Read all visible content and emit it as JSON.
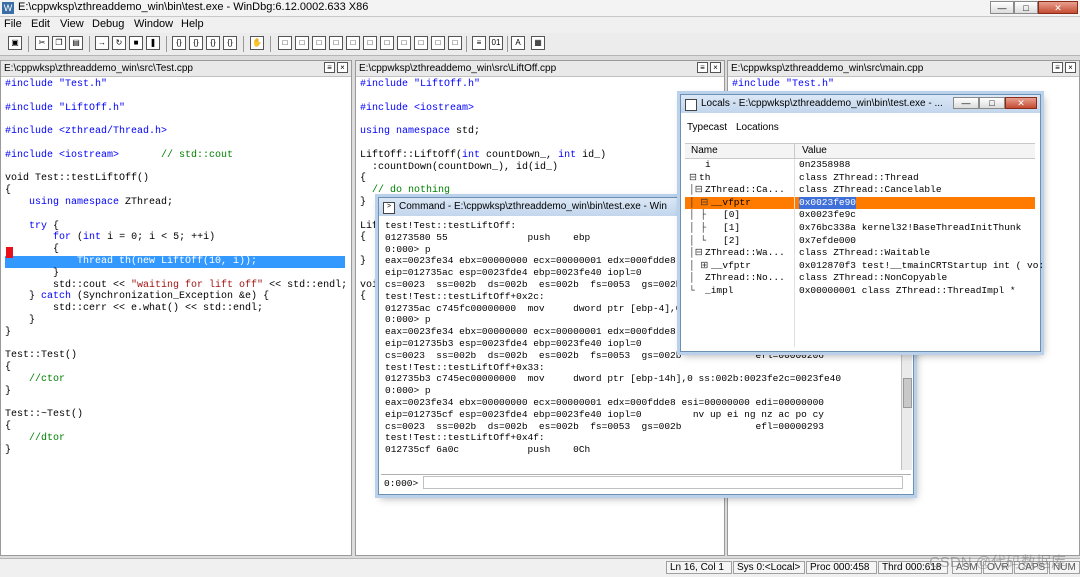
{
  "app": {
    "title": "E:\\cppwksp\\zthreaddemo_win\\bin\\test.exe - WinDbg:6.12.0002.633 X86",
    "icon": "windbg-icon"
  },
  "menu": [
    "File",
    "Edit",
    "View",
    "Debug",
    "Window",
    "Help"
  ],
  "panes": {
    "test": {
      "path": "E:\\cppwksp\\zthreaddemo_win\\src\\Test.cpp",
      "lines": [
        [
          {
            "t": "#include \"Test.h\"",
            "c": "kw"
          }
        ],
        [
          {
            "t": "",
            "c": ""
          }
        ],
        [
          {
            "t": "#include \"LiftOff.h\"",
            "c": "kw"
          }
        ],
        [
          {
            "t": "",
            "c": ""
          }
        ],
        [
          {
            "t": "#include <zthread/Thread.h>",
            "c": "kw"
          }
        ],
        [
          {
            "t": "",
            "c": ""
          }
        ],
        [
          {
            "t": "#include <iostream>",
            "c": "kw"
          },
          {
            "t": "       // std::cout",
            "c": "cm"
          }
        ],
        [
          {
            "t": "",
            "c": ""
          }
        ],
        [
          {
            "t": "void Test::testLiftOff()",
            "c": ""
          }
        ],
        [
          {
            "t": "{",
            "c": ""
          }
        ],
        [
          {
            "t": "    ",
            "c": ""
          },
          {
            "t": "using namespace",
            "c": "kw"
          },
          {
            "t": " ZThread;",
            "c": ""
          }
        ],
        [
          {
            "t": "",
            "c": ""
          }
        ],
        [
          {
            "t": "    ",
            "c": ""
          },
          {
            "t": "try",
            "c": "kw"
          },
          {
            "t": " {",
            "c": ""
          }
        ],
        [
          {
            "t": "        ",
            "c": ""
          },
          {
            "t": "for",
            "c": "kw"
          },
          {
            "t": " (",
            "c": ""
          },
          {
            "t": "int",
            "c": "kw"
          },
          {
            "t": " i = 0; i < 5; ++i)",
            "c": ""
          }
        ],
        [
          {
            "t": "        {",
            "c": ""
          }
        ],
        [
          {
            "t": "            Thread th(new LiftOff(10, i));",
            "c": "hl"
          }
        ],
        [
          {
            "t": "        }",
            "c": ""
          }
        ],
        [
          {
            "t": "        std::cout << ",
            "c": ""
          },
          {
            "t": "\"waiting for lift off\"",
            "c": "str"
          },
          {
            "t": " << std::endl;",
            "c": ""
          }
        ],
        [
          {
            "t": "    } ",
            "c": ""
          },
          {
            "t": "catch",
            "c": "kw"
          },
          {
            "t": " (Synchronization_Exception &e) {",
            "c": ""
          }
        ],
        [
          {
            "t": "        std::cerr << e.what() << std::endl;",
            "c": ""
          }
        ],
        [
          {
            "t": "    }",
            "c": ""
          }
        ],
        [
          {
            "t": "}",
            "c": ""
          }
        ],
        [
          {
            "t": "",
            "c": ""
          }
        ],
        [
          {
            "t": "Test::Test()",
            "c": ""
          }
        ],
        [
          {
            "t": "{",
            "c": ""
          }
        ],
        [
          {
            "t": "    ",
            "c": ""
          },
          {
            "t": "//ctor",
            "c": "cm"
          }
        ],
        [
          {
            "t": "}",
            "c": ""
          }
        ],
        [
          {
            "t": "",
            "c": ""
          }
        ],
        [
          {
            "t": "Test::~Test()",
            "c": ""
          }
        ],
        [
          {
            "t": "{",
            "c": ""
          }
        ],
        [
          {
            "t": "    ",
            "c": ""
          },
          {
            "t": "//dtor",
            "c": "cm"
          }
        ],
        [
          {
            "t": "}",
            "c": ""
          }
        ]
      ]
    },
    "liftoff": {
      "path": "E:\\cppwksp\\zthreaddemo_win\\src\\LiftOff.cpp",
      "lines": [
        [
          {
            "t": "#include \"LiftOff.h\"",
            "c": "kw"
          }
        ],
        [
          {
            "t": "",
            "c": ""
          }
        ],
        [
          {
            "t": "#include <iostream>",
            "c": "kw"
          }
        ],
        [
          {
            "t": "",
            "c": ""
          }
        ],
        [
          {
            "t": "using namespace",
            "c": "kw"
          },
          {
            "t": " std;",
            "c": ""
          }
        ],
        [
          {
            "t": "",
            "c": ""
          }
        ],
        [
          {
            "t": "LiftOff::LiftOff(",
            "c": ""
          },
          {
            "t": "int",
            "c": "kw"
          },
          {
            "t": " countDown_, ",
            "c": ""
          },
          {
            "t": "int",
            "c": "kw"
          },
          {
            "t": " id_)",
            "c": ""
          }
        ],
        [
          {
            "t": "  :countDown(countDown_), id(id_)",
            "c": ""
          }
        ],
        [
          {
            "t": "{",
            "c": ""
          }
        ],
        [
          {
            "t": "  ",
            "c": ""
          },
          {
            "t": "// do nothing",
            "c": "cm"
          }
        ],
        [
          {
            "t": "}",
            "c": ""
          }
        ],
        [
          {
            "t": "",
            "c": ""
          }
        ],
        [
          {
            "t": "Lif",
            "c": ""
          }
        ],
        [
          {
            "t": "{",
            "c": ""
          }
        ],
        [
          {
            "t": "",
            "c": ""
          }
        ],
        [
          {
            "t": "}",
            "c": ""
          }
        ],
        [
          {
            "t": "",
            "c": ""
          }
        ],
        [
          {
            "t": "voi",
            "c": ""
          }
        ],
        [
          {
            "t": "{",
            "c": ""
          }
        ]
      ]
    },
    "main": {
      "path": "E:\\cppwksp\\zthreaddemo_win\\src\\main.cpp",
      "lines": [
        [
          {
            "t": "#include \"Test.h\"",
            "c": "kw"
          }
        ]
      ]
    }
  },
  "command": {
    "title": "Command - E:\\cppwksp\\zthreaddemo_win\\bin\\test.exe - Win",
    "lines": [
      "test!Test::testLiftOff:",
      "01273580 55              push    ebp",
      "0:000> p",
      "eax=0023fe34 ebx=00000000 ecx=00000001 edx=000fdde8 e",
      "eip=012735ac esp=0023fde4 ebp=0023fe40 iopl=0",
      "cs=0023  ss=002b  ds=002b  es=002b  fs=0053  gs=002b",
      "test!Test::testLiftOff+0x2c:",
      "012735ac c745fc00000000  mov     dword ptr [ebp-4],0",
      "0:000> p",
      "eax=0023fe34 ebx=00000000 ecx=00000001 edx=000fdde8 e",
      "eip=012735b3 esp=0023fde4 ebp=0023fe40 iopl=0",
      "cs=0023  ss=002b  ds=002b  es=002b  fs=0053  gs=002b             efl=00000206",
      "test!Test::testLiftOff+0x33:",
      "012735b3 c745ec00000000  mov     dword ptr [ebp-14h],0 ss:002b:0023fe2c=0023fe40",
      "0:000> p",
      "eax=0023fe34 ebx=00000000 ecx=00000001 edx=000fdde8 esi=00000000 edi=00000000",
      "eip=012735cf esp=0023fde4 ebp=0023fe40 iopl=0         nv up ei ng nz ac po cy",
      "cs=0023  ss=002b  ds=002b  es=002b  fs=0053  gs=002b             efl=00000293",
      "test!Test::testLiftOff+0x4f:",
      "012735cf 6a0c            push    0Ch"
    ],
    "prompt": "0:000>",
    "input_value": ""
  },
  "locals": {
    "title": "Locals - E:\\cppwksp\\zthreaddemo_win\\bin\\test.exe - ...",
    "toolbar": [
      "Typecast",
      "Locations"
    ],
    "columns": [
      "Name",
      "Value"
    ],
    "rows": [
      {
        "tree": "  ",
        "name": "i",
        "value": "0n2358988"
      },
      {
        "tree": "⊟",
        "name": "th",
        "value": "class ZThread::Thread"
      },
      {
        "tree": "│⊟",
        "name": "ZThread::Ca...",
        "value": "class ZThread::Cancelable"
      },
      {
        "tree": "│ ⊟",
        "name": "__vfptr",
        "value": "0x0023fe90",
        "selected": true
      },
      {
        "tree": "│   ├",
        "name": "[0]",
        "value": "0x0023fe9c"
      },
      {
        "tree": "│   ├",
        "name": "[1]",
        "value": "0x76bc338a kernel32!BaseThreadInitThunk"
      },
      {
        "tree": "│   └",
        "name": "[2]",
        "value": "0x7efde000"
      },
      {
        "tree": "│⊟",
        "name": "ZThread::Wa...",
        "value": "class ZThread::Waitable"
      },
      {
        "tree": "│ ⊞",
        "name": "__vfptr",
        "value": "0x012870f3 test!__tmainCRTStartup int ( vo:"
      },
      {
        "tree": "│ ",
        "name": "ZThread::No...",
        "value": "class ZThread::NonCopyable"
      },
      {
        "tree": "└ ",
        "name": "_impl",
        "value": "0x00000001 class ZThread::ThreadImpl *"
      }
    ]
  },
  "status": {
    "cursor": "Ln 16, Col 1",
    "sys": "Sys 0:<Local>",
    "proc": "Proc 000:458",
    "thrd": "Thrd 000:618",
    "asm": "ASM",
    "ovr": "OVR",
    "caps": "CAPS",
    "num": "NUM"
  },
  "watermark": "CSDN @代码数据库"
}
